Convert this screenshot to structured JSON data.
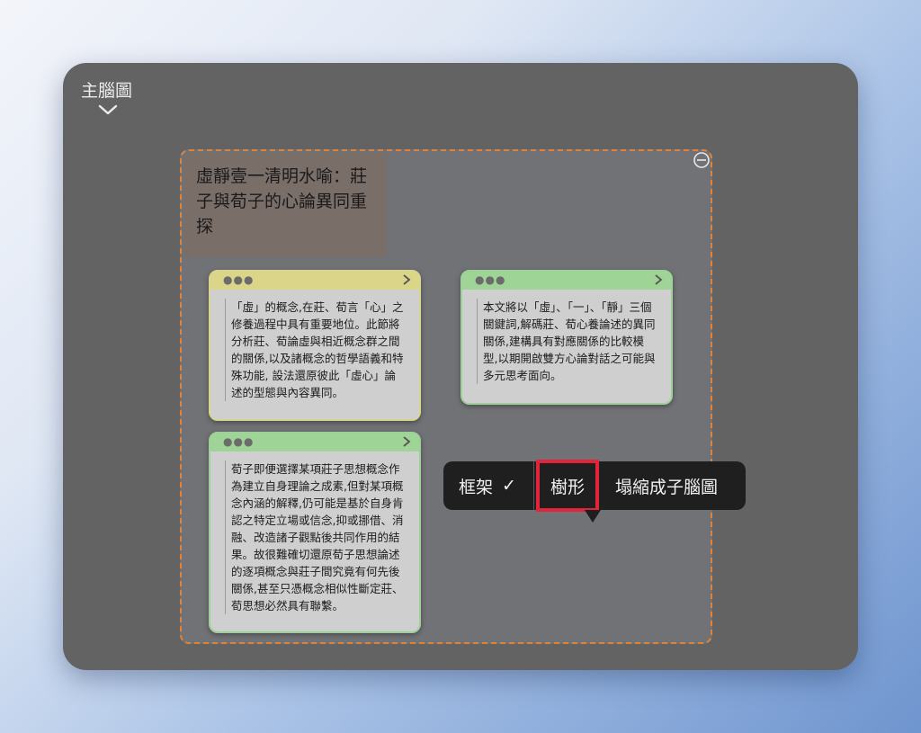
{
  "window": {
    "title": "主腦圖"
  },
  "frame": {
    "title": "虛靜壹一清明水喻：莊子與荀子的心論異同重探"
  },
  "notes": [
    {
      "color": "#dbd58a",
      "text": "「虛」的概念,在莊、荀言「心」之修養過程中具有重要地位。此節將分析莊、荀論虛與相近概念群之間的關係,以及諸概念的哲學語義和特殊功能, 設法還原彼此「虛心」論述的型態與內容異同。"
    },
    {
      "color": "#9ed495",
      "text": "本文將以「虛」、「一」、「靜」三個關鍵詞,解碼莊、荀心養論述的異同關係,建構具有對應關係的比較模型,以期開啟雙方心論對話之可能與多元思考面向。"
    },
    {
      "color": "#9ed495",
      "text": "荀子即便選擇某項莊子思想概念作為建立自身理論之成素,但對某項概念內涵的解釋,仍可能是基於自身肯認之特定立場或信念,抑或挪借、消融、改造諸子觀點後共同作用的結果。故很難確切還原荀子思想論述的逐項概念與莊子間究竟有何先後關係,甚至只憑概念相似性斷定莊、荀思想必然具有聯繫。"
    }
  ],
  "context_menu": {
    "frame_label": "框架",
    "frame_check": "✓",
    "tree_label": "樹形",
    "collapse_label": "塌縮成子腦圖"
  },
  "colors": {
    "frame_border": "#e0833a",
    "highlight": "#e2233a"
  }
}
